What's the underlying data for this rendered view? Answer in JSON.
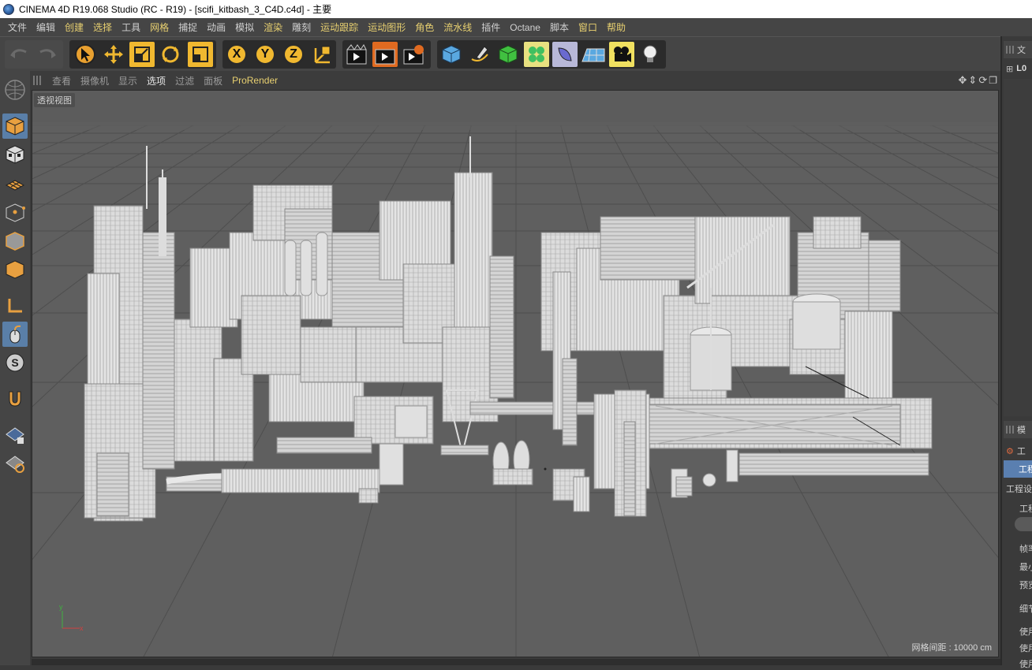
{
  "window": {
    "title": "CINEMA 4D R19.068 Studio (RC - R19) - [scifi_kitbash_3_C4D.c4d] - 主要"
  },
  "menu": [
    {
      "label": "文件",
      "hl": false
    },
    {
      "label": "编辑",
      "hl": false
    },
    {
      "label": "创建",
      "hl": true
    },
    {
      "label": "选择",
      "hl": true
    },
    {
      "label": "工具",
      "hl": false
    },
    {
      "label": "网格",
      "hl": true
    },
    {
      "label": "捕捉",
      "hl": false
    },
    {
      "label": "动画",
      "hl": false
    },
    {
      "label": "模拟",
      "hl": false
    },
    {
      "label": "渲染",
      "hl": true
    },
    {
      "label": "雕刻",
      "hl": false
    },
    {
      "label": "运动跟踪",
      "hl": true
    },
    {
      "label": "运动图形",
      "hl": true
    },
    {
      "label": "角色",
      "hl": true
    },
    {
      "label": "流水线",
      "hl": true
    },
    {
      "label": "插件",
      "hl": false
    },
    {
      "label": "Octane",
      "hl": false
    },
    {
      "label": "脚本",
      "hl": false
    },
    {
      "label": "窗口",
      "hl": true
    },
    {
      "label": "帮助",
      "hl": true
    }
  ],
  "viewport_menu": {
    "view": "查看",
    "cameras": "摄像机",
    "display": "显示",
    "options": "选项",
    "filter": "过滤",
    "panel": "面板",
    "prorender": "ProRender"
  },
  "viewport": {
    "label": "透视视图",
    "grid_spacing": "网格间距 : 10000 cm"
  },
  "toolbar_axes": [
    "X",
    "Y",
    "Z"
  ],
  "right_panel": {
    "top_tab": "文",
    "top_icon_text": "L0",
    "section_tab": "模",
    "item_1": "工",
    "item_2_selected": "工程",
    "project_settings": "工程设",
    "texts": [
      "工程",
      "帧率",
      "最小",
      "预览",
      "细节",
      "使用",
      "使用",
      "使用"
    ]
  },
  "colors": {
    "accent": "#f0b830",
    "viewport_bg": "#5f5f5f",
    "menu_highlight": "#e8d070"
  }
}
